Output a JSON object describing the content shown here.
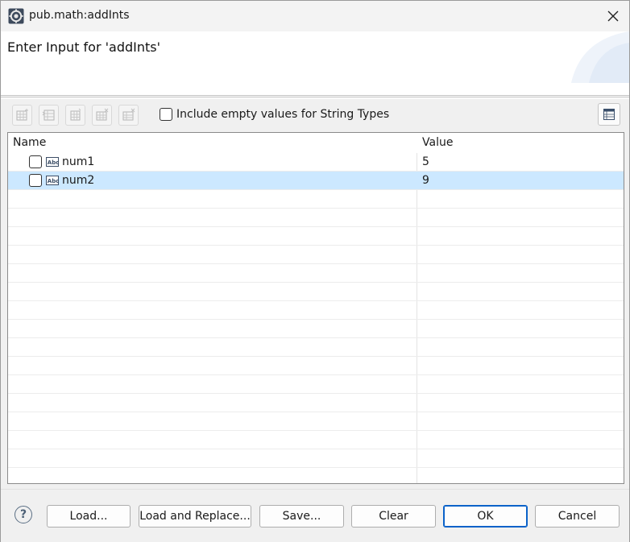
{
  "window": {
    "title": "pub.math:addInts"
  },
  "banner": {
    "title": "Enter Input for 'addInts'"
  },
  "toolbar": {
    "include_empty_label": "Include empty values for String Types",
    "include_empty_checked": false
  },
  "table": {
    "columns": [
      "Name",
      "Value"
    ],
    "rows": [
      {
        "name": "num1",
        "value": "5",
        "icon": "string-type-icon",
        "selected": false
      },
      {
        "name": "num2",
        "value": "9",
        "icon": "string-type-icon",
        "selected": true
      }
    ]
  },
  "footer": {
    "load_label": "Load...",
    "load_replace_label": "Load and Replace...",
    "save_label": "Save...",
    "clear_label": "Clear",
    "ok_label": "OK",
    "cancel_label": "Cancel"
  },
  "colors": {
    "selection": "#cce8ff",
    "default_button_border": "#0a62c9"
  }
}
